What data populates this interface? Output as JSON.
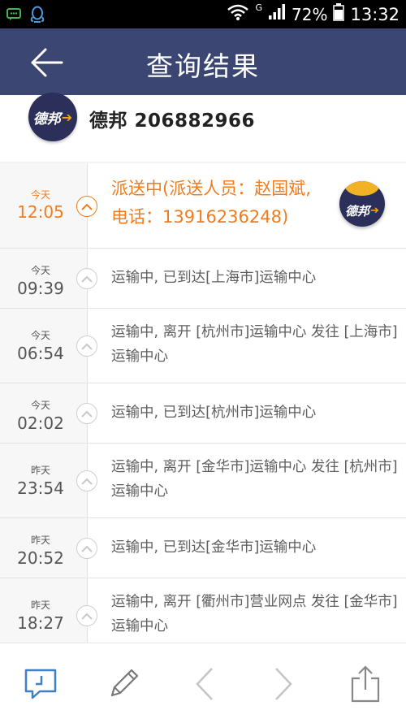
{
  "status_bar": {
    "network_type": "G",
    "battery": "72%",
    "time": "13:32",
    "icons": [
      "chat-notification-icon",
      "qq-icon",
      "wifi-icon",
      "signal-icon",
      "battery-icon"
    ]
  },
  "app_bar": {
    "title": "查询结果",
    "back_icon": "arrow-left-icon"
  },
  "carrier": {
    "name": "德邦",
    "tracking_number": "206882966",
    "logo_text": "德邦"
  },
  "events": [
    {
      "day": "今天",
      "time": "12:05",
      "text": "派送中(派送人员：赵国斌,电话：13916236248)",
      "active": true
    },
    {
      "day": "今天",
      "time": "09:39",
      "text": "运输中, 已到达[上海市]运输中心",
      "active": false
    },
    {
      "day": "今天",
      "time": "06:54",
      "text": "运输中, 离开 [杭州市]运输中心 发往 [上海市]运输中心",
      "active": false
    },
    {
      "day": "今天",
      "time": "02:02",
      "text": "运输中, 已到达[杭州市]运输中心",
      "active": false
    },
    {
      "day": "昨天",
      "time": "23:54",
      "text": "运输中, 离开 [金华市]运输中心 发往 [杭州市]运输中心",
      "active": false
    },
    {
      "day": "昨天",
      "time": "20:52",
      "text": "运输中, 已到达[金华市]运输中心",
      "active": false
    },
    {
      "day": "昨天",
      "time": "18:27",
      "text": "运输中, 离开 [衢州市]营业网点 发往 [金华市]运输中心",
      "active": false
    }
  ],
  "toolbar": {
    "icons": [
      "comment-icon",
      "edit-pencil-icon",
      "previous-chevron-icon",
      "next-chevron-icon",
      "share-icon"
    ]
  },
  "colors": {
    "app_bar": "#3b4772",
    "accent": "#f07c1e",
    "logo_bg": "#2c2f5a",
    "logo_arrow": "#f2a516",
    "toolbar_icon": "#3f7fc4"
  }
}
